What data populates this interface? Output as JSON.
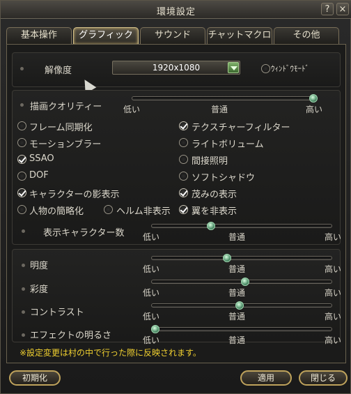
{
  "window": {
    "title": "環境設定",
    "help_label": "?",
    "close_label": "×"
  },
  "tabs": [
    {
      "label": "基本操作",
      "active": false
    },
    {
      "label": "グラフィック",
      "active": true
    },
    {
      "label": "サウンド",
      "active": false
    },
    {
      "label": "チャットマクロ",
      "active": false
    },
    {
      "label": "その他",
      "active": false
    }
  ],
  "resolution": {
    "label": "解像度",
    "value": "1920x1080",
    "window_mode_label": "ｳｨﾝﾄﾞｳﾓｰﾄﾞ",
    "window_mode": false
  },
  "quality": {
    "label": "描画クオリティー",
    "low": "低い",
    "mid": "普通",
    "high": "高い",
    "level": 1.0
  },
  "options": [
    {
      "label": "フレーム同期化",
      "checked": false
    },
    {
      "label": "テクスチャーフィルター",
      "checked": true
    },
    {
      "label": "モーションブラー",
      "checked": false
    },
    {
      "label": "ライトボリューム",
      "checked": false
    },
    {
      "label": "SSAO",
      "checked": true
    },
    {
      "label": "間接照明",
      "checked": false
    },
    {
      "label": "DOF",
      "checked": false
    },
    {
      "label": "ソフトシャドウ",
      "checked": false
    },
    {
      "label": "キャラクターの影表示",
      "checked": true
    },
    {
      "label": "茂みの表示",
      "checked": true
    },
    {
      "label": "人物の簡略化",
      "checked": false
    },
    {
      "label": "ヘルム非表示",
      "checked": false
    },
    {
      "label": "翼を非表示",
      "checked": true
    }
  ],
  "char_count": {
    "label": "表示キャラクター数",
    "low": "低い",
    "mid": "普通",
    "high": "高い",
    "level": 0.33
  },
  "adjust": [
    {
      "label": "明度",
      "low": "低い",
      "mid": "普通",
      "high": "高い",
      "level": 0.42
    },
    {
      "label": "彩度",
      "low": "低い",
      "mid": "普通",
      "high": "高い",
      "level": 0.52
    },
    {
      "label": "コントラスト",
      "low": "低い",
      "mid": "普通",
      "high": "高い",
      "level": 0.49
    },
    {
      "label": "エフェクトの明るさ",
      "low": "低い",
      "mid": "普通",
      "high": "高い",
      "level": 0.02
    }
  ],
  "note": "※設定変更は村の中で行った際に反映されます。",
  "buttons": {
    "reset": "初期化",
    "apply": "適用",
    "close": "閉じる"
  }
}
